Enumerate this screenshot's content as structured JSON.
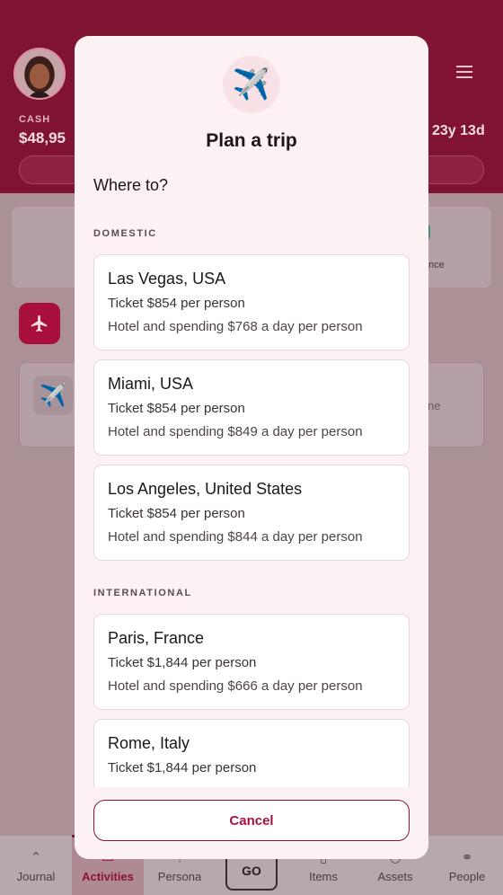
{
  "header": {
    "cash_label": "CASH",
    "cash_value": "$48,95",
    "age_value": "23y 13d"
  },
  "background": {
    "finance_text": "nce",
    "card_text": "ne"
  },
  "modal": {
    "title": "Plan a trip",
    "subtitle": "Where to?",
    "icon": "airplane-icon",
    "sections": [
      {
        "header": "DOMESTIC",
        "destinations": [
          {
            "name": "Las Vegas, USA",
            "ticket": "Ticket $854 per person",
            "hotel": "Hotel and spending $768 a day per person"
          },
          {
            "name": "Miami, USA",
            "ticket": "Ticket $854 per person",
            "hotel": "Hotel and spending $849 a day per person"
          },
          {
            "name": "Los Angeles, United States",
            "ticket": "Ticket $854 per person",
            "hotel": "Hotel and spending $844 a day per person"
          }
        ]
      },
      {
        "header": "INTERNATIONAL",
        "destinations": [
          {
            "name": "Paris, France",
            "ticket": "Ticket $1,844 per person",
            "hotel": "Hotel and spending $666 a day per person"
          },
          {
            "name": "Rome, Italy",
            "ticket": "Ticket $1,844 per person",
            "hotel": ""
          }
        ]
      }
    ],
    "cancel_label": "Cancel"
  },
  "nav": {
    "items": [
      {
        "label": "Journal",
        "icon": "journal-icon"
      },
      {
        "label": "Activities",
        "icon": "activities-icon",
        "active": true
      },
      {
        "label": "Persona",
        "icon": "persona-icon"
      },
      {
        "label": "Items",
        "icon": "items-icon"
      },
      {
        "label": "Assets",
        "icon": "assets-icon"
      },
      {
        "label": "People",
        "icon": "people-icon"
      }
    ],
    "go_label": "GO"
  },
  "colors": {
    "brand": "#801232",
    "accent": "#a5123d",
    "modal_bg": "#fdf2f3"
  }
}
